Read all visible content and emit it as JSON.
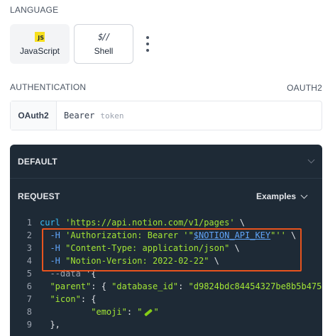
{
  "language": {
    "label": "LANGUAGE",
    "options": [
      {
        "label": "JavaScript",
        "icon": "javascript-icon",
        "icon_text": "JS",
        "selected": true
      },
      {
        "label": "Shell",
        "icon": "shell-icon",
        "icon_text": "$//",
        "selected": false
      }
    ],
    "more_icon": "kebab-menu-icon"
  },
  "authentication": {
    "label": "AUTHENTICATION",
    "scheme": "OAUTH2",
    "type": "OAuth2",
    "prefix": "Bearer",
    "placeholder": "token"
  },
  "panel": {
    "default_label": "DEFAULT",
    "request_label": "REQUEST",
    "examples_label": "Examples",
    "highlight_color": "#e8541e",
    "background": "#1e2a36"
  },
  "code": {
    "line_numbers": [
      "1",
      "2",
      "3",
      "4",
      "5",
      "6",
      "7",
      "8",
      "9"
    ],
    "l1_cmd": "curl",
    "l1_url": "'https://api.notion.com/v1/pages'",
    "l1_tail": " \\",
    "l2_flag": "-H",
    "l2_open": "'Authorization: Bearer '\"",
    "l2_var": "$NOTION_API_KEY",
    "l2_close": "\"''",
    "l2_tail": " \\",
    "l3_flag": "-H",
    "l3_str": "\"Content-Type: application/json\"",
    "l3_tail": " \\",
    "l4_flag": "-H",
    "l4_str": "\"Notion-Version: 2022-02-22\"",
    "l4_tail": " \\",
    "l5_flag": "--data",
    "l5_tail": " '{",
    "l6_key": "\"parent\"",
    "l6_mid": ": { ",
    "l6_key2": "\"database_id\"",
    "l6_colon": ": ",
    "l6_val": "\"d9824bdc84454327be8b5b475",
    "l7_key": "\"icon\"",
    "l7_tail": ": {",
    "l8_key": "\"emoji\"",
    "l8_colon": ": ",
    "l8_open": "\"",
    "l8_close": "\"",
    "l9_text": "},"
  }
}
